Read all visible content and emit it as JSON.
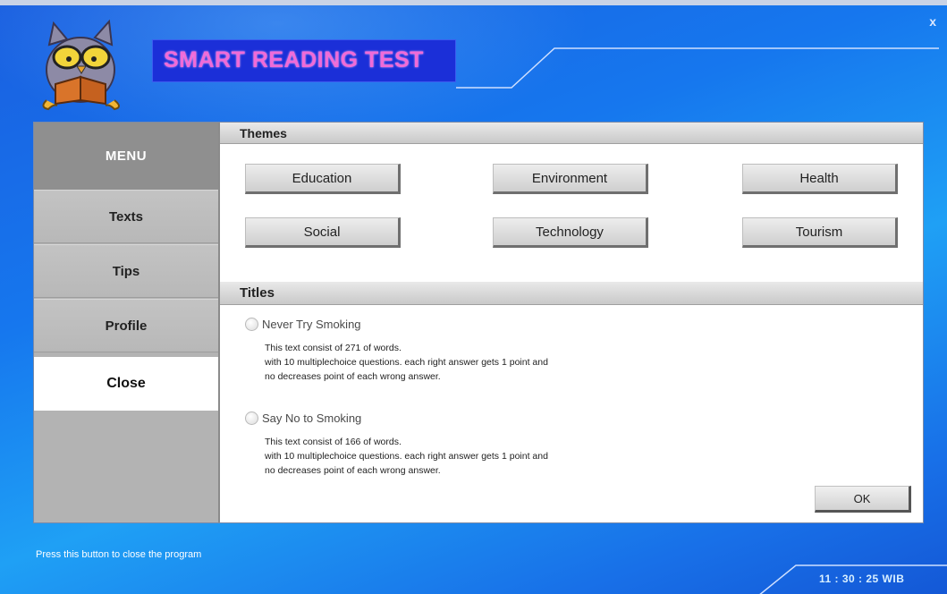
{
  "window": {
    "title": "SMART READING TEST",
    "close_label": "x"
  },
  "menu": {
    "header": "MENU",
    "items": [
      {
        "label": "Texts"
      },
      {
        "label": "Tips"
      },
      {
        "label": "Profile"
      },
      {
        "label": "Close",
        "active": true
      }
    ]
  },
  "themes": {
    "heading": "Themes",
    "buttons": [
      "Education",
      "Environment",
      "Health",
      "Social",
      "Technology",
      "Tourism"
    ]
  },
  "titles": {
    "heading": "Titles",
    "items": [
      {
        "label": "Never Try Smoking",
        "desc_line1": "This text consist of 271 of words.",
        "desc_line2": "with 10 multiplechoice questions. each right answer gets 1 point and",
        "desc_line3": "no decreases point of each wrong answer."
      },
      {
        "label": "Say No to Smoking",
        "desc_line1": "This text consist of 166 of words.",
        "desc_line2": "with 10 multiplechoice questions. each right answer gets 1 point and",
        "desc_line3": "no decreases point of each wrong answer."
      }
    ]
  },
  "ok_label": "OK",
  "status": {
    "hint": "Press this button to close the program",
    "clock": "11 : 30 : 25  WIB"
  },
  "colors": {
    "title_text": "#f06bd8",
    "title_box": "#1b2fd8",
    "background": "#1677ee",
    "menu": "#b3b3b3"
  }
}
